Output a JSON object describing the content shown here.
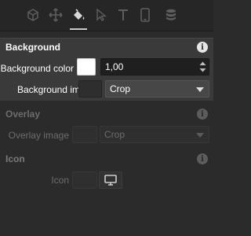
{
  "toolbar": {
    "tools": [
      {
        "name": "cube-icon"
      },
      {
        "name": "move-icon"
      },
      {
        "name": "paint-bucket-icon",
        "active": true
      },
      {
        "name": "cursor-icon"
      },
      {
        "name": "text-icon"
      },
      {
        "name": "phone-icon"
      },
      {
        "name": "database-icon"
      }
    ]
  },
  "background": {
    "title": "Background",
    "color_label": "Background color",
    "color_value": "#ffffff",
    "opacity_value": "1,00",
    "image_label": "Background image",
    "image_mode": "Crop"
  },
  "overlay": {
    "title": "Overlay",
    "image_label": "Overlay image",
    "image_mode": "Crop"
  },
  "icon_section": {
    "title": "Icon",
    "icon_label": "Icon"
  },
  "info_glyph": "i"
}
